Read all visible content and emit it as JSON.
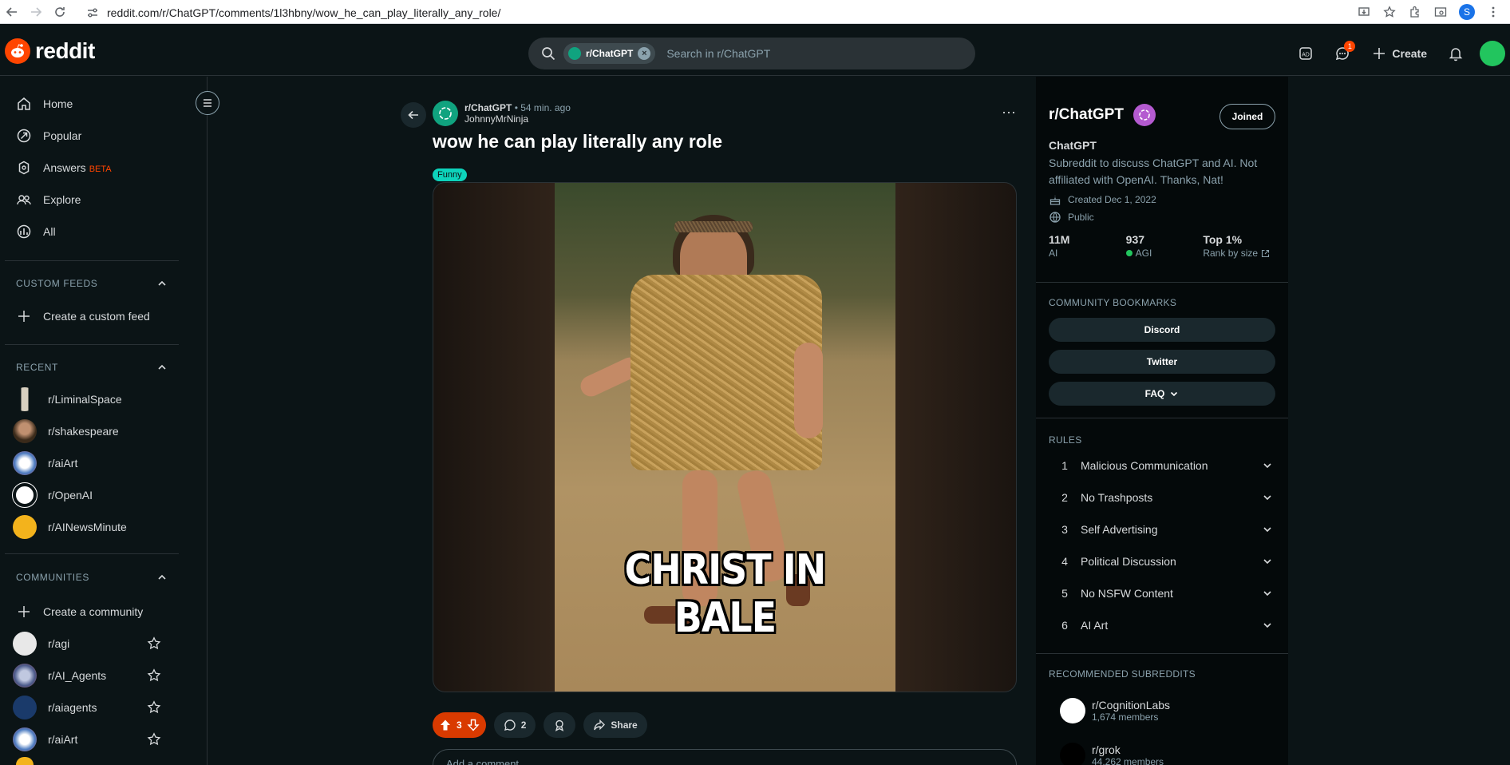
{
  "browser": {
    "url": "reddit.com/r/ChatGPT/comments/1l3hbny/wow_he_can_play_literally_any_role/",
    "profile_initial": "S"
  },
  "header": {
    "logo_text": "reddit",
    "search_chip": "r/ChatGPT",
    "search_placeholder": "Search in r/ChatGPT",
    "chat_badge": "1",
    "create_label": "Create"
  },
  "sidebar": {
    "nav": [
      {
        "label": "Home",
        "icon": "home-icon"
      },
      {
        "label": "Popular",
        "icon": "popular-icon"
      },
      {
        "label": "Answers",
        "icon": "answers-icon",
        "badge": "BETA"
      },
      {
        "label": "Explore",
        "icon": "explore-icon"
      },
      {
        "label": "All",
        "icon": "all-icon"
      }
    ],
    "custom_feeds_heading": "CUSTOM FEEDS",
    "create_custom_feed": "Create a custom feed",
    "recent_heading": "RECENT",
    "recent": [
      "r/LiminalSpace",
      "r/shakespeare",
      "r/aiArt",
      "r/OpenAI",
      "r/AINewsMinute"
    ],
    "communities_heading": "COMMUNITIES",
    "create_community": "Create a community",
    "communities": [
      "r/agi",
      "r/AI_Agents",
      "r/aiagents",
      "r/aiArt"
    ]
  },
  "post": {
    "subreddit": "r/ChatGPT",
    "time": "• 54 min. ago",
    "author": "JohnnyMrNinja",
    "title": "wow he can play literally any role",
    "flair": "Funny",
    "image_caption": "CHRIST IN BALE",
    "votes": "3",
    "comments": "2",
    "share_label": "Share",
    "comment_placeholder": "Add a comment"
  },
  "community": {
    "title": "r/ChatGPT",
    "joined_label": "Joined",
    "name": "ChatGPT",
    "description": "Subreddit to discuss ChatGPT and AI. Not affiliated with OpenAI. Thanks, Nat!",
    "created": "Created Dec 1, 2022",
    "visibility": "Public",
    "stats": [
      {
        "value": "11M",
        "label": "AI"
      },
      {
        "value": "937",
        "label": "AGI"
      },
      {
        "value": "Top 1%",
        "label": "Rank by size"
      }
    ],
    "bookmarks_heading": "COMMUNITY BOOKMARKS",
    "bookmarks": [
      "Discord",
      "Twitter",
      "FAQ"
    ],
    "rules_heading": "RULES",
    "rules": [
      {
        "n": "1",
        "text": "Malicious Communication"
      },
      {
        "n": "2",
        "text": "No Trashposts"
      },
      {
        "n": "3",
        "text": "Self Advertising"
      },
      {
        "n": "4",
        "text": "Political Discussion"
      },
      {
        "n": "5",
        "text": "No NSFW Content"
      },
      {
        "n": "6",
        "text": "AI Art"
      }
    ],
    "recommended_heading": "RECOMMENDED SUBREDDITS",
    "recommended": [
      {
        "name": "r/CognitionLabs",
        "members": "1,674 members"
      },
      {
        "name": "r/grok",
        "members": "44,262 members"
      }
    ]
  },
  "colors": {
    "accent": "#ff4500",
    "background": "#0b1416",
    "flair": "#0dd3bb",
    "upvote_active": "#d93a00"
  }
}
